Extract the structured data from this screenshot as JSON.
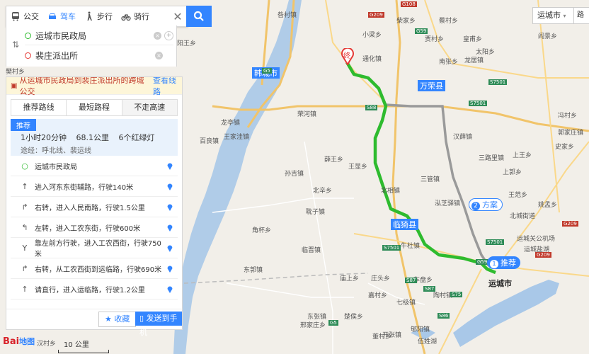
{
  "modes": [
    {
      "label": "公交",
      "icon": "bus-icon"
    },
    {
      "label": "驾车",
      "icon": "car-icon"
    },
    {
      "label": "步行",
      "icon": "walk-icon"
    },
    {
      "label": "骑行",
      "icon": "bike-icon"
    }
  ],
  "close_glyph": "✕",
  "route": {
    "start": "运城市民政局",
    "end": "裴庄派出所"
  },
  "notice": {
    "text": "从运城市民政局到裴庄派出所的跨城公交",
    "link": "查看线路"
  },
  "tabs": [
    "推荐路线",
    "最短路程",
    "不走高速"
  ],
  "recommend": {
    "badge": "推荐",
    "time": "1小时20分钟",
    "distance": "68.1公里",
    "lights": "6个红绿灯",
    "via": "途经：呼北线、裴运线"
  },
  "steps": [
    {
      "icon": "start-dot-icon",
      "text": "运城市民政局"
    },
    {
      "icon": "straight-arrow-icon",
      "text": "进入河东东街辅路，行驶140米"
    },
    {
      "icon": "turn-right-icon",
      "text": "右转，进入人民南路，行驶1.5公里"
    },
    {
      "icon": "turn-left-icon",
      "text": "左转，进入工农东街，行驶600米"
    },
    {
      "icon": "keep-left-icon",
      "text": "靠左前方行驶，进入工农西街，行驶750米"
    },
    {
      "icon": "turn-right-icon",
      "text": "右转，从工农西街到运临路，行驶690米"
    },
    {
      "icon": "straight-arrow-icon",
      "text": "请直行，进入运临路，行驶1.2公里"
    }
  ],
  "footer": {
    "fav": "收藏",
    "send": "发送到手机"
  },
  "city_select": "运城市",
  "right_btn": "路",
  "logo": {
    "bai": "Bai",
    "du": "地图"
  },
  "scale": "10 公里",
  "map": {
    "end_marker": "终",
    "rec_badge": "推荐",
    "rec_num": "1",
    "plan_badge": "方案",
    "plan_num": "2",
    "city_labels": [
      {
        "name": "韩城市",
        "hl": true
      },
      {
        "name": "万荣县",
        "hl": true
      },
      {
        "name": "临猗县",
        "hl": true
      },
      {
        "name": "运城市",
        "hl": false
      }
    ],
    "town_labels": [
      "昝村镇",
      "柴家乡",
      "蔡村乡",
      "小梁乡",
      "贾村乡",
      "皇甫乡",
      "太阳乡",
      "阎景乡",
      "通化镇",
      "南张乡",
      "荣河镇",
      "薛王乡",
      "龙亭镇",
      "王家洼镇",
      "百良镇",
      "王显乡",
      "孙吉镇",
      "北辛乡",
      "三管镇",
      "汉薛镇",
      "泓芝驿镇",
      "北相镇",
      "上郭乡",
      "三路里镇",
      "王范乡",
      "姚孟乡",
      "北城街道",
      "运城盐湖",
      "东郭镇",
      "角杯乡",
      "牛杜镇",
      "临晋镇",
      "耽子镇",
      "庙上乡",
      "东张镇",
      "楚侯乡",
      "邢家庄乡",
      "郇阳镇",
      "伍姓湖",
      "七级镇",
      "开张镇",
      "嘉村乡",
      "董村乡",
      "汉村乡",
      "樊村乡",
      "阳王乡",
      "冯村乡",
      "郭家庄镇",
      "上王乡",
      "史家乡",
      "龙居镇",
      "陶村镇",
      "运城关公机场",
      "车盘乡",
      "庄头乡"
    ],
    "roads": [
      "G209",
      "G59",
      "G5",
      "G108",
      "S88",
      "S87",
      "G5",
      "S7501",
      "G209",
      "S7501",
      "G59",
      "S75",
      "G209",
      "S87",
      "S86",
      "S7501",
      "S7501"
    ]
  }
}
